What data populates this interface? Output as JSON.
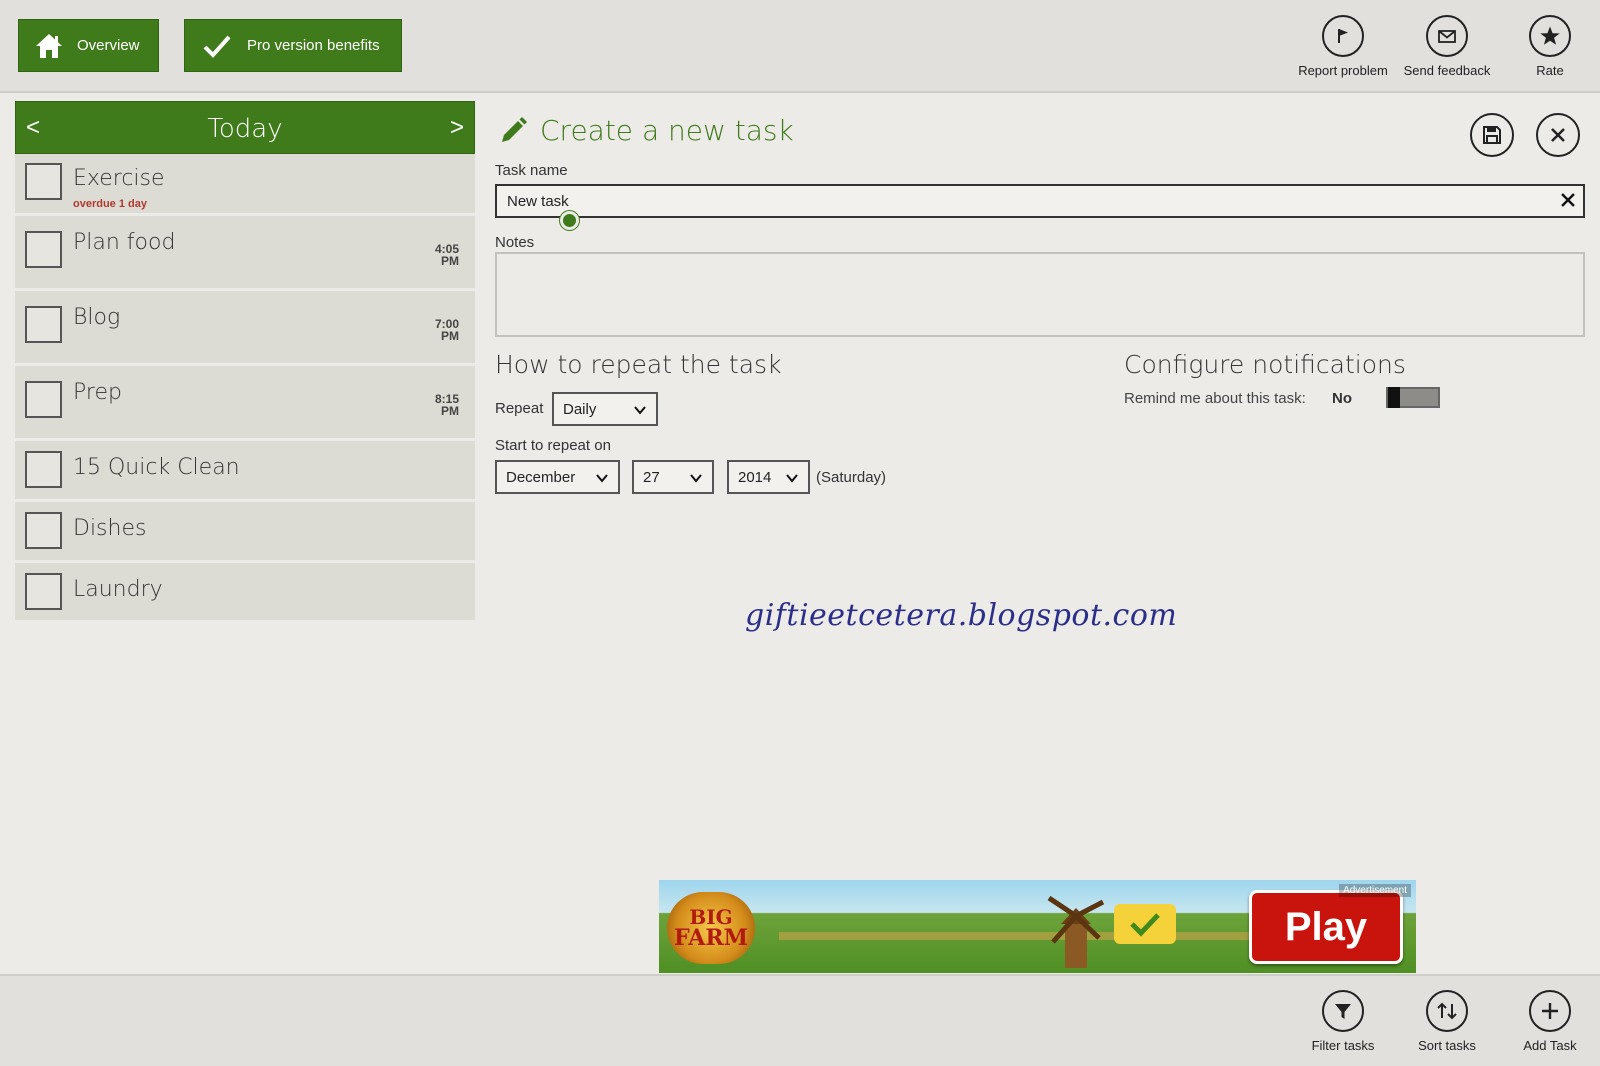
{
  "top_nav": {
    "overview_label": "Overview",
    "pro_label": "Pro version benefits"
  },
  "top_commands": {
    "report_label": "Report problem",
    "feedback_label": "Send feedback",
    "rate_label": "Rate"
  },
  "day_panel": {
    "prev": "<",
    "title": "Today",
    "next": ">"
  },
  "tasks": [
    {
      "name": "Exercise",
      "due": "overdue 1 day",
      "time": "",
      "period": ""
    },
    {
      "name": "Plan food",
      "due": "",
      "time": "4:05",
      "period": "PM"
    },
    {
      "name": "Blog",
      "due": "",
      "time": "7:00",
      "period": "PM"
    },
    {
      "name": "Prep",
      "due": "",
      "time": "8:15",
      "period": "PM"
    },
    {
      "name": "15 Quick Clean",
      "due": "",
      "time": "",
      "period": ""
    },
    {
      "name": "Dishes",
      "due": "",
      "time": "",
      "period": ""
    },
    {
      "name": "Laundry",
      "due": "",
      "time": "",
      "period": ""
    }
  ],
  "form": {
    "title": "Create a new task",
    "task_name_label": "Task name",
    "task_name_value": "New task",
    "notes_label": "Notes",
    "notes_value": "",
    "repeat_section_title": "How to repeat the task",
    "repeat_label": "Repeat",
    "repeat_value": "Daily",
    "start_label": "Start to repeat on",
    "start_month": "December",
    "start_day": "27",
    "start_year": "2014",
    "weekday": "(Saturday)",
    "notify_section_title": "Configure notifications",
    "remind_label": "Remind me about this task:",
    "remind_value": "No"
  },
  "watermark": "giftieetcetera.blogspot.com",
  "ad": {
    "tag": "Advertisement",
    "logo_line1": "BIG",
    "logo_line2": "FARM",
    "cta": "Play"
  },
  "bottom_commands": {
    "filter_label": "Filter tasks",
    "sort_label": "Sort tasks",
    "add_label": "Add Task"
  },
  "colors": {
    "accent_green": "#3f7b1a",
    "overdue_red": "#b03a2e",
    "watermark_blue": "#2b2f8a"
  },
  "icons": {
    "overview": "home-icon",
    "pro": "checkmark-icon",
    "report": "flag-icon",
    "feedback": "envelope-icon",
    "rate": "star-icon",
    "title": "pencil-icon",
    "save": "save-icon",
    "close": "close-icon",
    "filter": "filter-icon",
    "sort": "sort-icon",
    "add": "plus-icon"
  }
}
